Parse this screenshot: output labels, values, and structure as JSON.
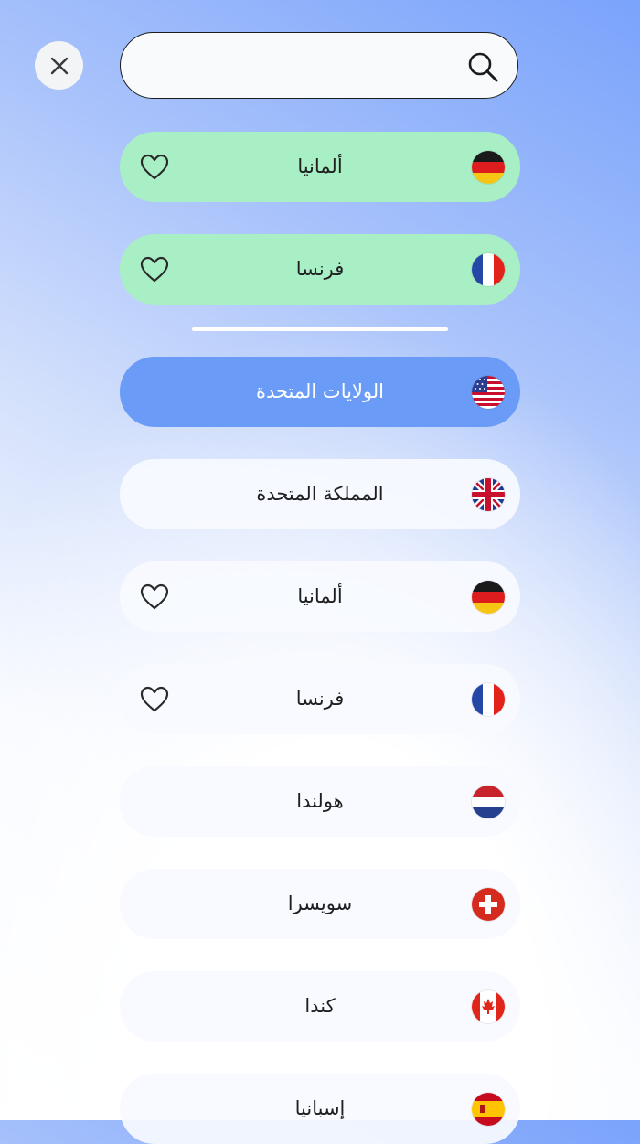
{
  "search": {
    "placeholder": "",
    "value": ""
  },
  "favorites": [
    {
      "label": "ألمانيا",
      "flag": "germany-flag-icon",
      "favorited": true
    },
    {
      "label": "فرنسا",
      "flag": "france-flag-icon",
      "favorited": true
    }
  ],
  "countries": [
    {
      "label": "الولايات المتحدة",
      "flag": "usa-flag-icon",
      "selected": true
    },
    {
      "label": "المملكة المتحدة",
      "flag": "uk-flag-icon"
    },
    {
      "label": "ألمانيا",
      "flag": "germany-flag-icon",
      "heart": true
    },
    {
      "label": "فرنسا",
      "flag": "france-flag-icon",
      "heart": true
    },
    {
      "label": "هولندا",
      "flag": "netherlands-flag-icon"
    },
    {
      "label": "سويسرا",
      "flag": "switzerland-flag-icon"
    },
    {
      "label": "كندا",
      "flag": "canada-flag-icon"
    },
    {
      "label": "إسبانيا",
      "flag": "spain-flag-icon"
    }
  ],
  "colors": {
    "favorite_row": "#a9efc5",
    "selected_row": "#6a9cf7",
    "normal_row": "#f8faff"
  }
}
